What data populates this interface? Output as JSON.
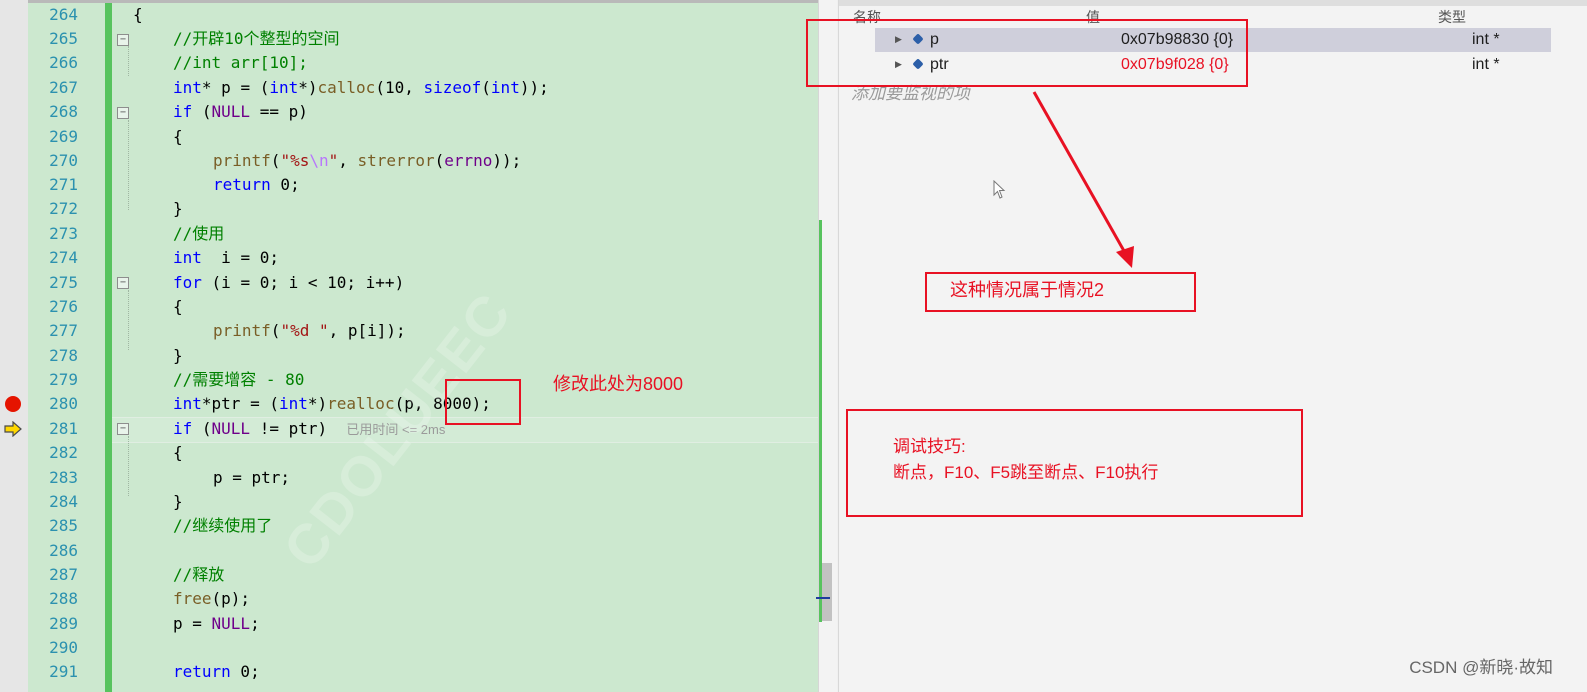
{
  "editor": {
    "line_numbers": [
      "264",
      "265",
      "266",
      "267",
      "268",
      "269",
      "270",
      "271",
      "272",
      "273",
      "274",
      "275",
      "276",
      "277",
      "278",
      "279",
      "280",
      "281",
      "282",
      "283",
      "284",
      "285",
      "286",
      "287",
      "288",
      "289",
      "290",
      "291"
    ],
    "lines": {
      "l264": "{",
      "l265": "//开辟10个整型的空间",
      "l266": "//int arr[10];",
      "l267": {
        "kw1": "int",
        "t1": "* p = (",
        "kw2": "int",
        "t2": "*)",
        "fn": "calloc",
        "t3": "(10, ",
        "kw3": "sizeof",
        "t4": "(",
        "kw4": "int",
        "t5": "));"
      },
      "l268": {
        "kw": "if",
        "t1": " (",
        "mc": "NULL",
        "t2": " == p)"
      },
      "l269": "{",
      "l270": {
        "fn": "printf",
        "t1": "(",
        "st1": "\"%s",
        "esc": "\\n",
        "st2": "\"",
        "t2": ", ",
        "fn2": "strerror",
        "t3": "(",
        "mc": "errno",
        "t4": "));"
      },
      "l271": {
        "kw": "return",
        "t1": " 0;"
      },
      "l272": "}",
      "l273": "//使用",
      "l274": {
        "kw": "int",
        "t1": "  i = 0;"
      },
      "l275": {
        "kw": "for",
        "t1": " (i = 0; i < 10; i++)"
      },
      "l276": "{",
      "l277": {
        "fn": "printf",
        "t1": "(",
        "st": "\"%d \"",
        "t2": ", p[i]);"
      },
      "l278": "}",
      "l279": "//需要增容 - 80",
      "l280": {
        "kw1": "int",
        "t1": "*ptr = (",
        "kw2": "int",
        "t2": "*)",
        "fn": "realloc",
        "t3": "(p, ",
        "num": "8000",
        "t4": ");"
      },
      "l281": {
        "kw": "if",
        "t1": " (",
        "mc": "NULL",
        "t2": " != ptr)",
        "hint": "已用时间 <= 2ms"
      },
      "l282": "{",
      "l283": "p = ptr;",
      "l284": "}",
      "l285": "//继续使用了",
      "l286": "",
      "l287": "//释放",
      "l288": {
        "fn": "free",
        "t1": "(p);"
      },
      "l289": {
        "t1": "p = ",
        "mc": "NULL",
        "t2": ";"
      },
      "l290": "",
      "l291": {
        "kw": "return",
        "t1": " 0;"
      }
    },
    "watermark": "CDOLUEEC",
    "annotation_modify": "修改此处为8000"
  },
  "watch": {
    "headers": {
      "name": "名称",
      "value": "值",
      "type": "类型"
    },
    "rows": [
      {
        "name": "p",
        "value": "0x07b98830 {0}",
        "type": "int *",
        "changed": false
      },
      {
        "name": "ptr",
        "value": "0x07b9f028 {0}",
        "type": "int *",
        "changed": true
      }
    ],
    "add_placeholder": "添加要监视的项"
  },
  "annotations": {
    "case_note": "这种情况属于情况2",
    "tips_title": "调试技巧:",
    "tips_body": "断点，F10、F5跳至断点、F10执行"
  },
  "footer": {
    "credit": "CSDN @新晓·故知"
  },
  "colors": {
    "editor_bg": "#cce8cf",
    "line_number": "#2b91af",
    "keyword": "#0000ff",
    "comment": "#008000",
    "annotation_red": "#e81123",
    "breakpoint": "#e51400"
  },
  "icons": [
    "breakpoint-icon",
    "execution-arrow-icon",
    "expand-triangle-icon",
    "variable-cube-icon",
    "mouse-cursor-icon"
  ]
}
